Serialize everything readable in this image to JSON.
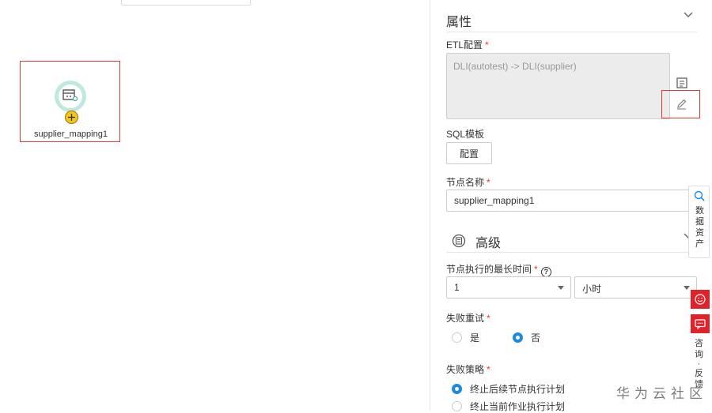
{
  "canvas": {
    "node": {
      "label": "supplier_mapping1",
      "icon": "table-transform-icon",
      "add_icon": "plus-circle-icon"
    }
  },
  "panel": {
    "title": "属性",
    "etl": {
      "label": "ETL配置",
      "required": "*",
      "value": "DLI(autotest) -> DLI(supplier)",
      "side_icon": "format-icon",
      "edit_icon": "pencil-icon"
    },
    "sql": {
      "label": "SQL模板",
      "button": "配置"
    },
    "node_name": {
      "label": "节点名称",
      "required": "*",
      "value": "supplier_mapping1"
    },
    "advanced": {
      "label": "高级",
      "icon": "list-circle-icon"
    },
    "max_time": {
      "label": "节点执行的最长时间",
      "required": "*",
      "help": "?",
      "value": "1",
      "unit": "小时"
    },
    "retry": {
      "label": "失败重试",
      "required": "*",
      "options": [
        "是",
        "否"
      ],
      "selected": "否"
    },
    "policy": {
      "label": "失败策略",
      "required": "*",
      "options": [
        "终止后续节点执行计划",
        "终止当前作业执行计划"
      ],
      "selected": "终止后续节点执行计划"
    }
  },
  "side_tools": {
    "asset": {
      "icon": "search-icon",
      "chars": [
        "数",
        "据",
        "资",
        "产"
      ]
    },
    "smile_icon": "smile-icon",
    "chat_icon": "chat-icon",
    "feedback_chars": [
      "咨",
      "询",
      "·",
      "反",
      "馈"
    ]
  },
  "watermark": "华为云社区",
  "colors": {
    "required": "#e53935",
    "accent": "#1e88e5",
    "side_red": "#e0232a",
    "node_ring": "#bfe8df",
    "highlight": "#e53935"
  }
}
